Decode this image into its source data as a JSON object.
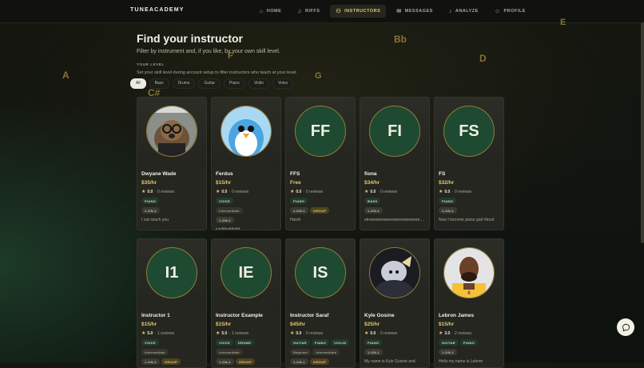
{
  "app": {
    "logo": "TUNEACADEMY"
  },
  "nav": [
    {
      "label": "HOME",
      "icon": "home-icon",
      "glyph": "⌂",
      "active": false
    },
    {
      "label": "RIFFS",
      "icon": "music-icon",
      "glyph": "♫",
      "active": false
    },
    {
      "label": "INSTRUCTORS",
      "icon": "users-icon",
      "glyph": "⚇",
      "active": true
    },
    {
      "label": "MESSAGES",
      "icon": "message-icon",
      "glyph": "✉",
      "active": false
    },
    {
      "label": "ANALYZE",
      "icon": "mic-icon",
      "glyph": "♪",
      "active": false
    },
    {
      "label": "PROFILE",
      "icon": "user-icon",
      "glyph": "☺",
      "active": false
    }
  ],
  "decor_notes": [
    "A",
    "C#",
    "F",
    "G",
    "Bb",
    "D",
    "E"
  ],
  "header": {
    "title": "Find your instructor",
    "subtitle": "Filter by instrument and, if you like, by your own skill level.",
    "level_label": "YOUR LEVEL",
    "level_hint": "Set your skill level during account setup to filter instructors who teach at your level."
  },
  "filters": [
    "All",
    "Bass",
    "Drums",
    "Guitar",
    "Piano",
    "Violin",
    "Voice"
  ],
  "active_filter": "All",
  "instructors": [
    {
      "name": "Dwyane Wade",
      "initials": "",
      "photo": "glasses-dog",
      "price": "$35/hr",
      "rating": "0.0",
      "reviews": "0 reviews",
      "instruments": [
        "PIANO"
      ],
      "levels": [],
      "formats": [
        "1-ON-1"
      ],
      "bio": "I can teach you"
    },
    {
      "name": "Ferdus",
      "initials": "",
      "photo": "penguin",
      "price": "$15/hr",
      "rating": "0.0",
      "reviews": "0 reviews",
      "instruments": [
        "VOICE"
      ],
      "levels": [
        "Intermediate"
      ],
      "formats": [
        "1-ON-1"
      ],
      "bio": "jcndjfjndjdnjfd"
    },
    {
      "name": "FFS",
      "initials": "FF",
      "photo": "",
      "price": "Free",
      "rating": "0.0",
      "reviews": "0 reviews",
      "instruments": [
        "PIANO"
      ],
      "levels": [],
      "formats": [
        "1-ON-1",
        "GROUP"
      ],
      "bio": "Harsh"
    },
    {
      "name": "fiona",
      "initials": "FI",
      "photo": "",
      "price": "$34/hr",
      "rating": "0.0",
      "reviews": "0 reviews",
      "instruments": [
        "BASS"
      ],
      "levels": [],
      "formats": [
        "1-ON-1"
      ],
      "bio": "etrewsreeeeeeeeeeeeeeeeeeeeeeeeeeeeee"
    },
    {
      "name": "FS",
      "initials": "FS",
      "photo": "",
      "price": "$32/hr",
      "rating": "0.0",
      "reviews": "0 reviews",
      "instruments": [
        "PIANO"
      ],
      "levels": [],
      "formats": [
        "1-ON-1"
      ],
      "bio": "Now I become piano god #trust"
    },
    {
      "name": "Instructor 1",
      "initials": "I1",
      "photo": "",
      "price": "$15/hr",
      "rating": "5.0",
      "reviews": "1 reviews",
      "instruments": [
        "VOICE"
      ],
      "levels": [
        "Intermediate"
      ],
      "formats": [
        "1-ON-1",
        "GROUP"
      ],
      "bio": ""
    },
    {
      "name": "Instructor Example",
      "initials": "IE",
      "photo": "",
      "price": "$15/hr",
      "rating": "5.0",
      "reviews": "1 reviews",
      "instruments": [
        "VOICE",
        "DRUMS"
      ],
      "levels": [
        "Intermediate"
      ],
      "formats": [
        "1-ON-1",
        "GROUP"
      ],
      "bio": ""
    },
    {
      "name": "Instructor Saraf",
      "initials": "IS",
      "photo": "",
      "price": "$45/hr",
      "rating": "0.0",
      "reviews": "0 reviews",
      "instruments": [
        "GUITAR",
        "PIANO",
        "VIOLIN"
      ],
      "levels": [
        "Beginner",
        "Intermediate"
      ],
      "formats": [
        "1-ON-1",
        "GROUP"
      ],
      "bio": ""
    },
    {
      "name": "Kyle Gosine",
      "initials": "",
      "photo": "dark-figure",
      "price": "$25/hr",
      "rating": "0.0",
      "reviews": "0 reviews",
      "instruments": [
        "PIANO"
      ],
      "levels": [],
      "formats": [
        "1-ON-1"
      ],
      "bio": "My name is Kyle Gosine and"
    },
    {
      "name": "Lebron James",
      "initials": "",
      "photo": "player",
      "price": "$15/hr",
      "rating": "3.0",
      "reviews": "2 reviews",
      "instruments": [
        "GUITAR",
        "PIANO"
      ],
      "levels": [],
      "formats": [
        "1-ON-1"
      ],
      "bio": "Hello my name is Lebron"
    }
  ],
  "colors": {
    "accent": "#e2c86a",
    "avatar_bg": "#1d4a30",
    "card_bg": "#252620"
  }
}
